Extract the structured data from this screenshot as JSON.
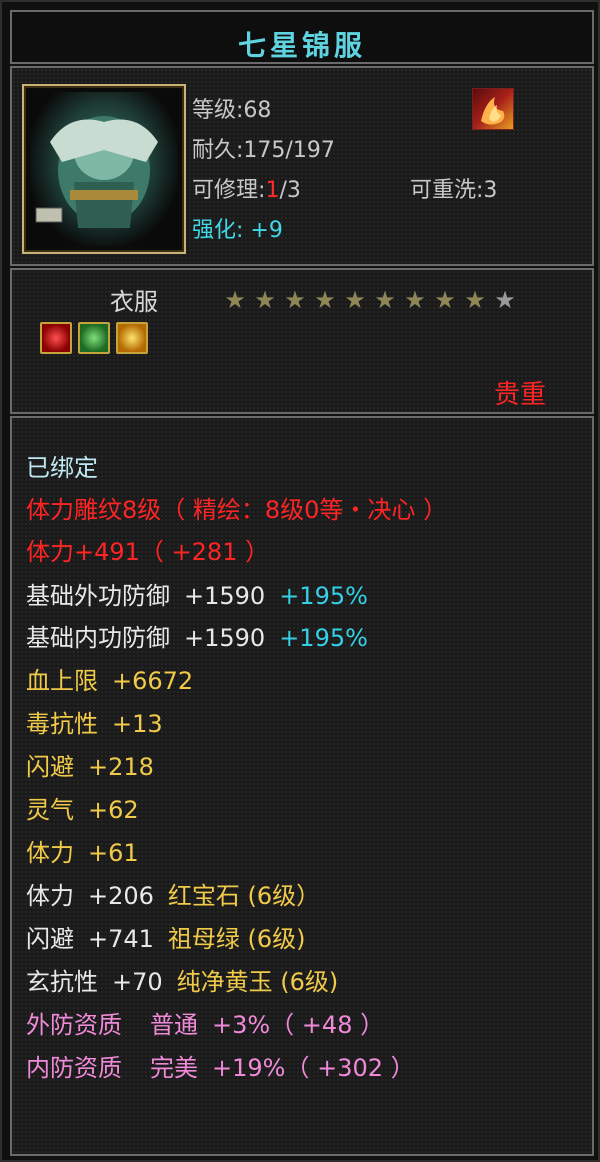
{
  "title": "七星锦服",
  "level_label": "等级",
  "level_value": ":68",
  "durability_label": "耐久",
  "durability_value": ":175/197",
  "repair_label": "可修理",
  "repair_sep": ":",
  "repair_current": "1",
  "repair_total": "/3",
  "rewash_label": "可重洗",
  "rewash_value": ":3",
  "enhance_label": "强化",
  "enhance_value": ":  +9",
  "item_type": "衣服",
  "stars_filled": 9,
  "stars_total": 10,
  "rarity": "贵重",
  "bound": "已绑定",
  "engrave": "体力雕纹8级（ 精绘：8级0等・决心 ）",
  "vitality_bonus": "体力+491（ +281 ）",
  "attrs": [
    {
      "name": "基础外功防御",
      "value": "+1590",
      "pct": "+195%"
    },
    {
      "name": "基础内功防御",
      "value": "+1590",
      "pct": "+195%"
    }
  ],
  "yellow_attrs": [
    {
      "name": "血上限",
      "value": "+6672"
    },
    {
      "name": "毒抗性",
      "value": "+13"
    },
    {
      "name": "闪避",
      "value": "+218"
    },
    {
      "name": "灵气",
      "value": "+62"
    },
    {
      "name": "体力",
      "value": "+61"
    }
  ],
  "gem_lines": [
    {
      "name": "体力",
      "value": "+206",
      "gem": "红宝石 (6级）"
    },
    {
      "name": "闪避",
      "value": "+741",
      "gem": "祖母绿 (6级)"
    },
    {
      "name": "玄抗性",
      "value": "+70",
      "gem": "纯净黄玉 (6级)"
    }
  ],
  "quality_lines": [
    {
      "name": "外防资质",
      "grade": "普通",
      "value": "+3%（ +48 ）"
    },
    {
      "name": "内防资质",
      "grade": "完美",
      "value": "+19%（ +302 ）"
    }
  ],
  "colors": {
    "title": "#5fd3e0",
    "rarity": "#ff2424",
    "yellow": "#f0ca48",
    "pink": "#f08ad8",
    "cyan": "#34d0e6"
  },
  "icons": {
    "item": "green-armor-icon",
    "badge": "fire-crest-icon",
    "gems": [
      "red-gem-icon",
      "green-gem-icon",
      "yellow-gem-icon"
    ]
  }
}
